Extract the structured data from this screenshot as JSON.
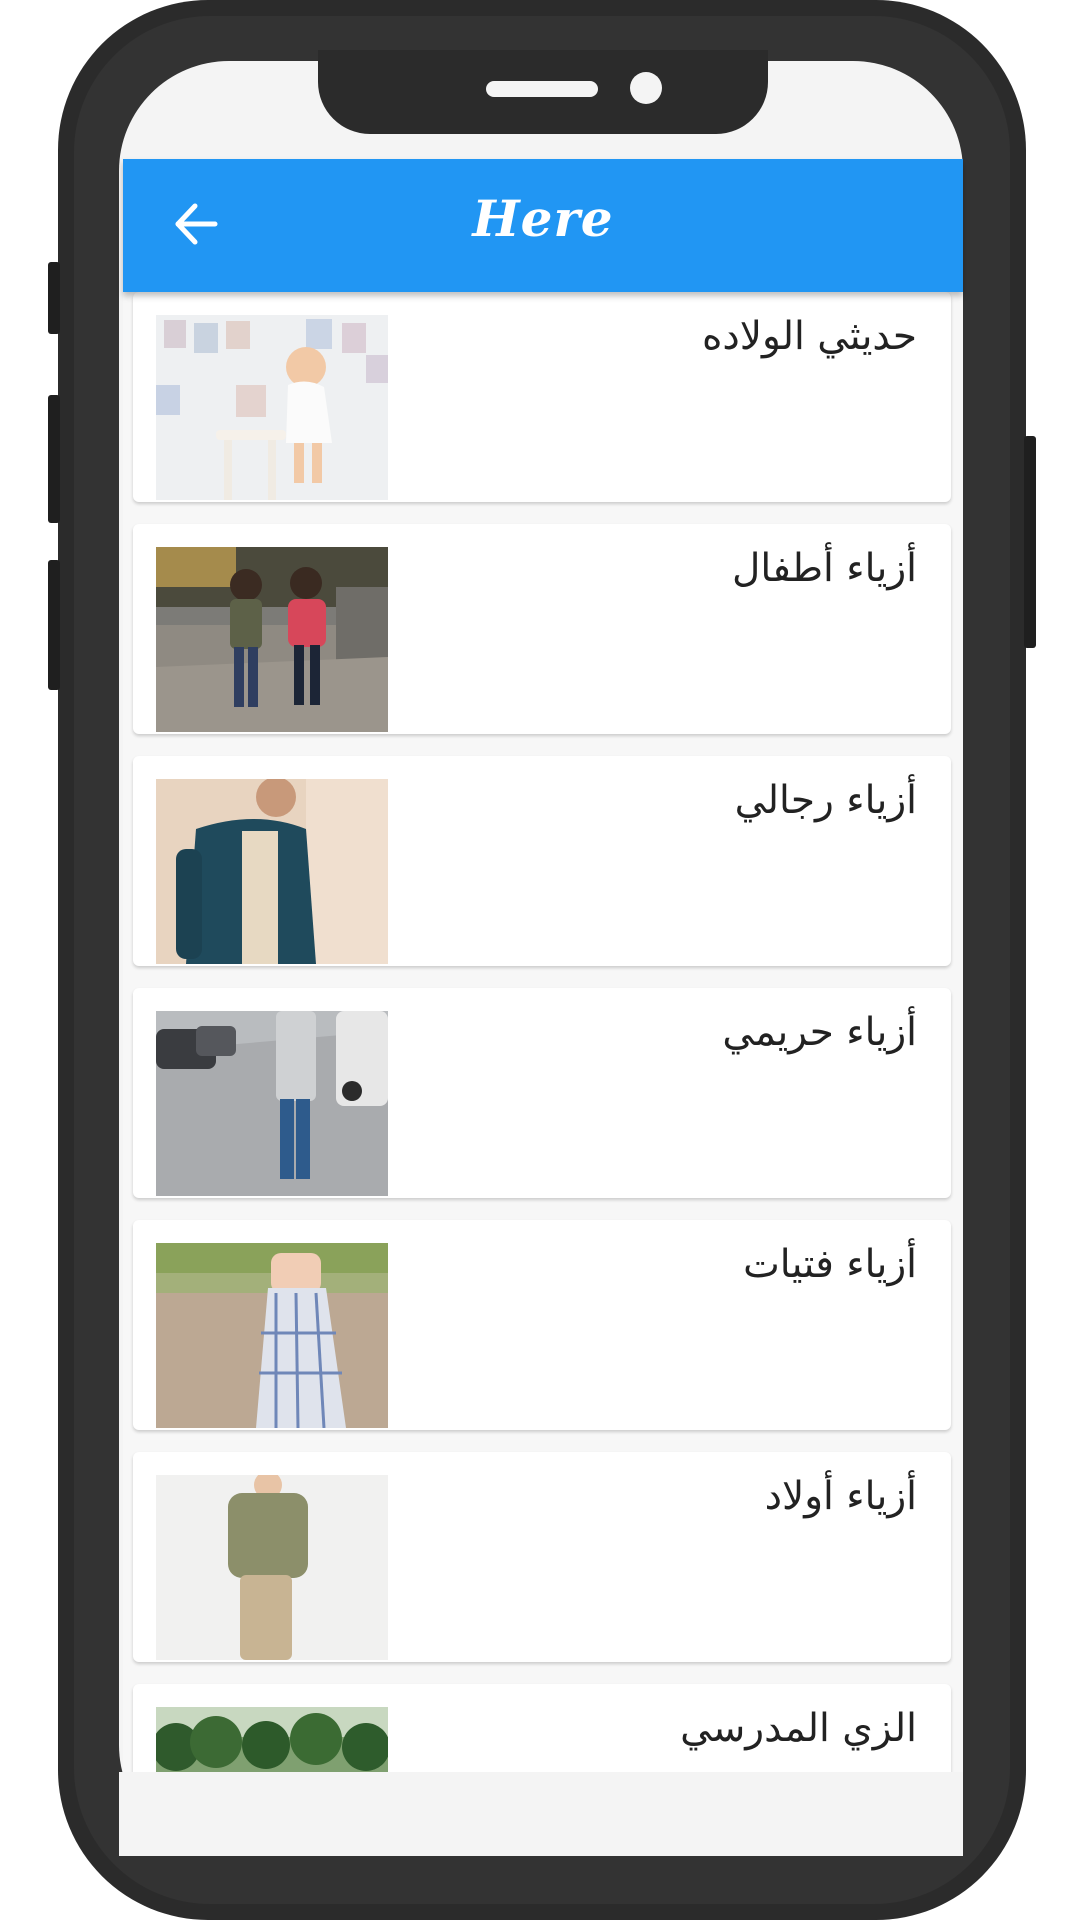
{
  "app_bar": {
    "title": "Here",
    "background_color": "#2196f3",
    "back_icon": "arrow-left-icon"
  },
  "categories": [
    {
      "label": "حديثي الولاده",
      "image": "newborn-photo"
    },
    {
      "label": "أزياء أطفال",
      "image": "kids-fashion-photo"
    },
    {
      "label": "أزياء رجالي",
      "image": "mens-fashion-photo"
    },
    {
      "label": "أزياء حريمي",
      "image": "womens-fashion-photo"
    },
    {
      "label": "أزياء فتيات",
      "image": "girls-fashion-photo"
    },
    {
      "label": "أزياء أولاد",
      "image": "boys-fashion-photo"
    },
    {
      "label": "الزي المدرسي",
      "image": "school-uniform-photo"
    }
  ]
}
